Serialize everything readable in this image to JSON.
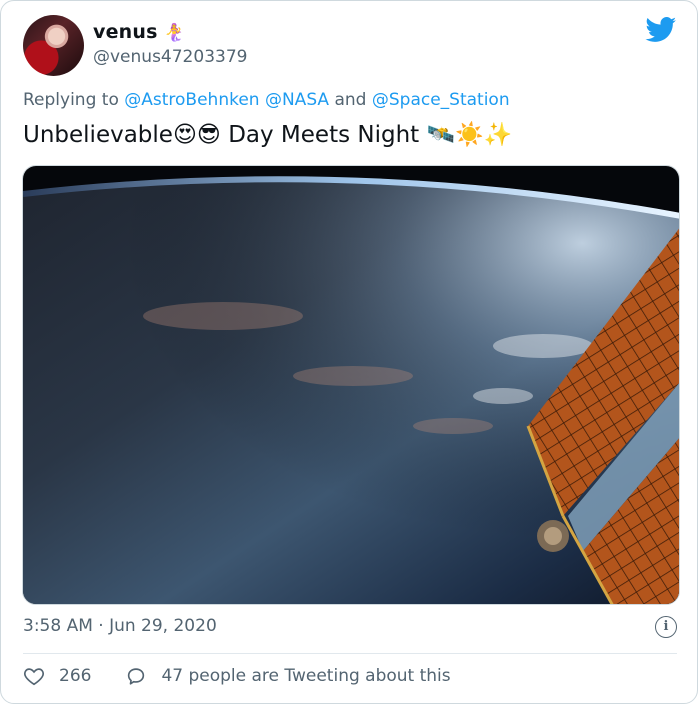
{
  "tweet": {
    "author_name": "venus",
    "name_emoji": "🧜‍♀️",
    "handle": "@venus47203379",
    "reply_prefix": "Replying to",
    "reply_mentions": [
      "@AstroBehnken",
      "@NASA",
      "and",
      "@Space_Station"
    ],
    "text": "Unbelievable😍😎 Day Meets Night 🛰️☀️✨",
    "timestamp": "3:58 AM · Jun 29, 2020",
    "likes": "266",
    "retweet_text": "47 people are Tweeting about this"
  },
  "icons": {
    "logo": "twitter-bird-icon",
    "info": "info-icon",
    "like": "heart-icon",
    "comment": "comment-icon"
  },
  "colors": {
    "accent": "#1d9bf0",
    "muted": "#536471",
    "border": "#cfd9de"
  }
}
